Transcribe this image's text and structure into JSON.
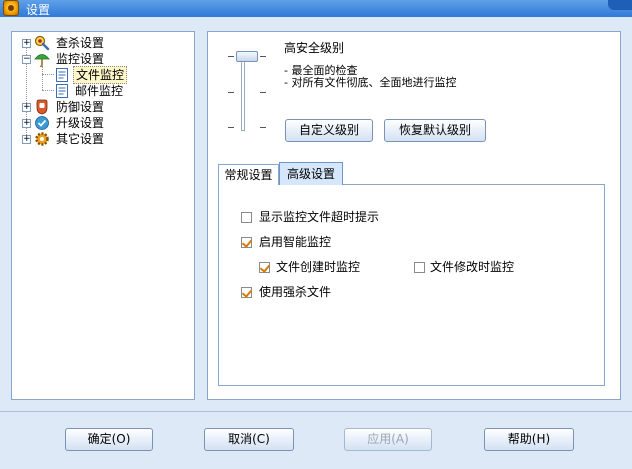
{
  "window": {
    "title": "设置"
  },
  "tree": {
    "items": [
      {
        "label": "查杀设置",
        "icon": "magnifier-virus-icon",
        "expander": "+"
      },
      {
        "label": "监控设置",
        "icon": "umbrella-monitor-icon",
        "expander": "−"
      },
      {
        "label": "文件监控",
        "icon": "file-doc-icon"
      },
      {
        "label": "邮件监控",
        "icon": "file-doc-icon"
      },
      {
        "label": "防御设置",
        "icon": "shield-glove-icon",
        "expander": "+"
      },
      {
        "label": "升级设置",
        "icon": "refresh-check-icon",
        "expander": "+"
      },
      {
        "label": "其它设置",
        "icon": "gear-icon",
        "expander": "+"
      }
    ]
  },
  "level": {
    "title": "高安全级别",
    "desc1": "- 最全面的检查",
    "desc2": "- 对所有文件彻底、全面地进行监控",
    "slider_level": 4,
    "slider_levels": 4
  },
  "buttons": {
    "custom_level": "自定义级别",
    "restore_default": "恢复默认级别",
    "ok": "确定(O)",
    "cancel": "取消(C)",
    "apply": "应用(A)",
    "help": "帮助(H)"
  },
  "tabs": [
    {
      "label": "常规设置",
      "active": false
    },
    {
      "label": "高级设置",
      "active": true
    }
  ],
  "options": {
    "timeout_prompt": {
      "label": "显示监控文件超时提示",
      "checked": false
    },
    "smart_monitor": {
      "label": "启用智能监控",
      "checked": true
    },
    "on_create": {
      "label": "文件创建时监控",
      "checked": true
    },
    "on_modify": {
      "label": "文件修改时监控",
      "checked": false
    },
    "force_kill": {
      "label": "使用强杀文件",
      "checked": true
    }
  },
  "colors": {
    "titlebar": "#2f7ad6",
    "background": "#dde9f7",
    "check": "#d47a00"
  }
}
